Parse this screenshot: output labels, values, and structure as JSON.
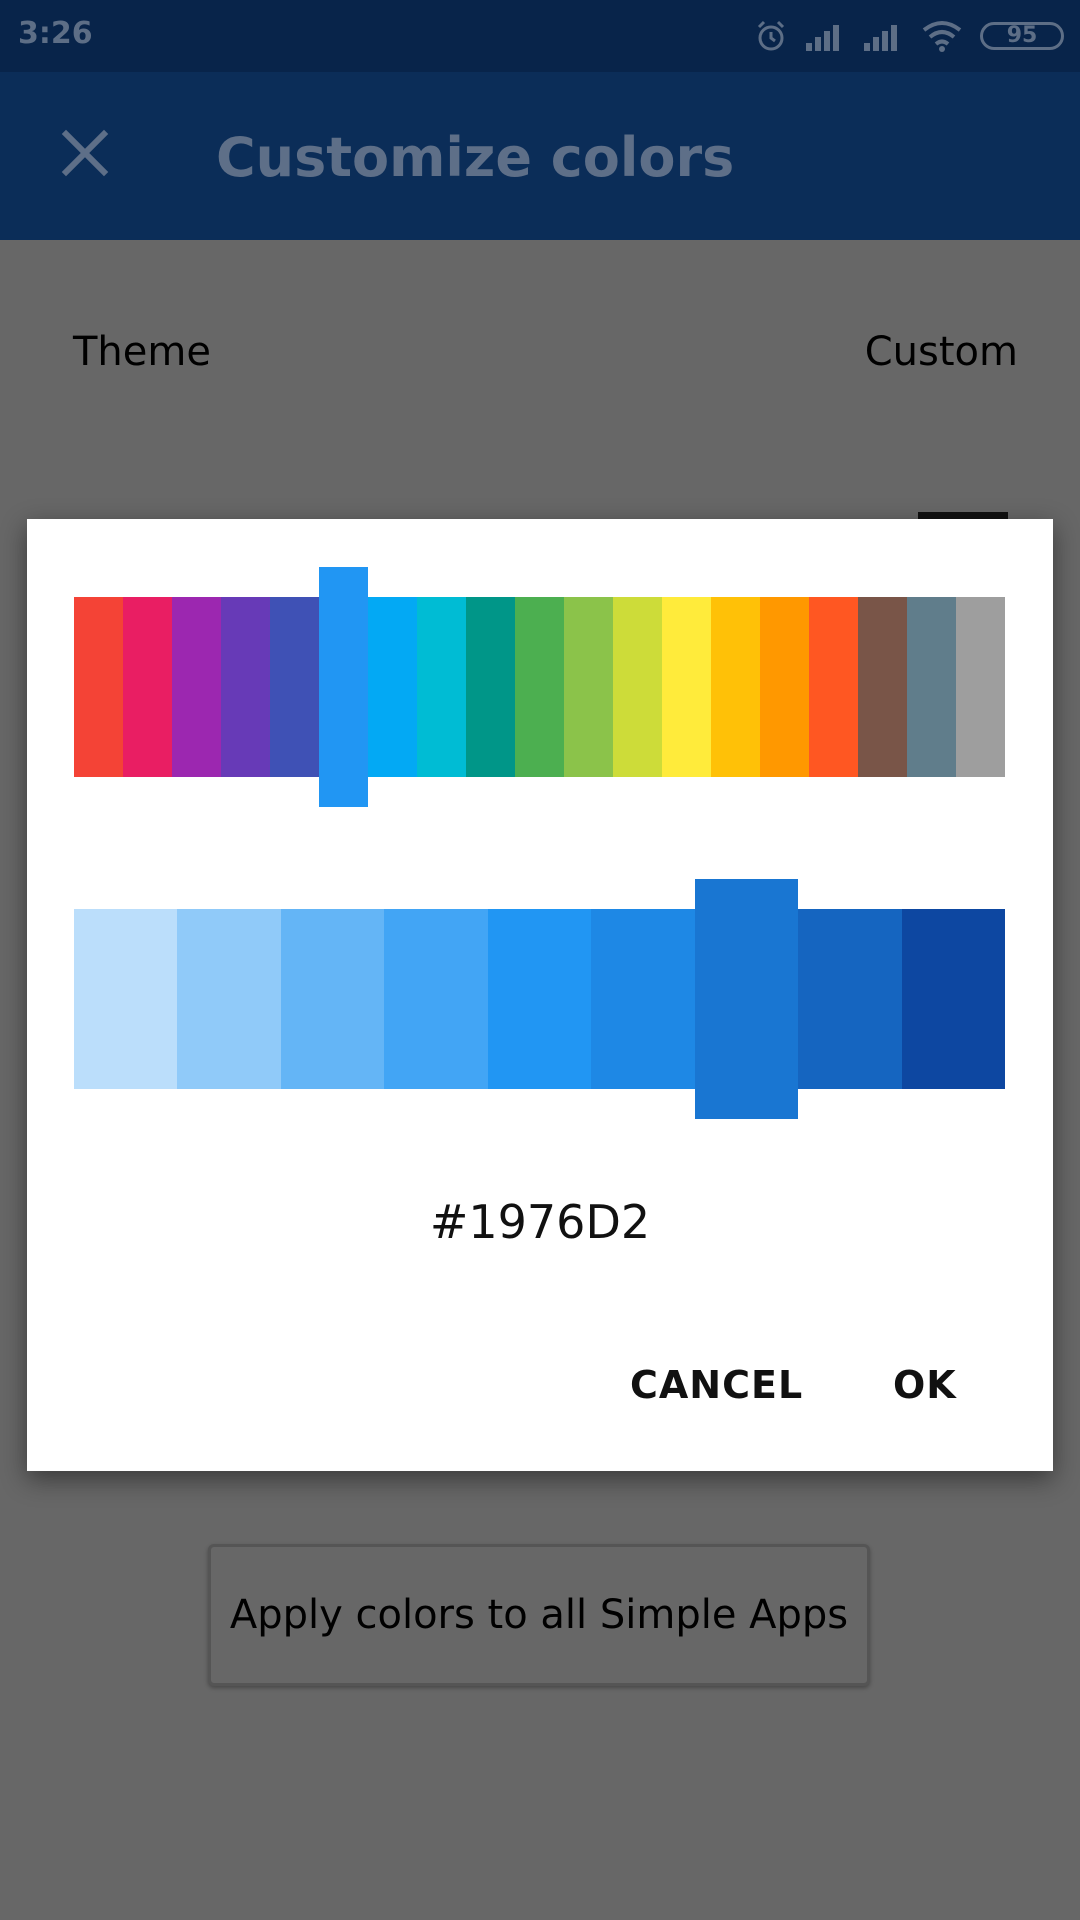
{
  "status_bar": {
    "time": "3:26",
    "battery": "95",
    "icons": [
      "alarm-icon",
      "signal-icon",
      "signal-icon",
      "wifi-icon",
      "battery-icon"
    ]
  },
  "app_bar": {
    "title": "Customize colors",
    "close_icon": "close-icon"
  },
  "settings": {
    "theme_label": "Theme",
    "theme_value": "Custom",
    "apply_button": "Apply colors to all Simple Apps"
  },
  "dialog": {
    "primary_colors": [
      "#F44336",
      "#E91E63",
      "#9C27B0",
      "#673AB7",
      "#3F51B5",
      "#2196F3",
      "#03A9F4",
      "#00BCD4",
      "#009688",
      "#4CAF50",
      "#8BC34A",
      "#CDDC39",
      "#FFEB3B",
      "#FFC107",
      "#FF9800",
      "#FF5722",
      "#795548",
      "#607D8B",
      "#9E9E9E"
    ],
    "selected_primary_index": 5,
    "shade_colors": [
      "#BBDEFB",
      "#90CAF9",
      "#64B5F6",
      "#42A5F5",
      "#2196F3",
      "#1E88E5",
      "#1976D2",
      "#1565C0",
      "#0D47A1"
    ],
    "selected_shade_index": 6,
    "hex_value": "#1976D2",
    "cancel_label": "CANCEL",
    "ok_label": "OK"
  }
}
